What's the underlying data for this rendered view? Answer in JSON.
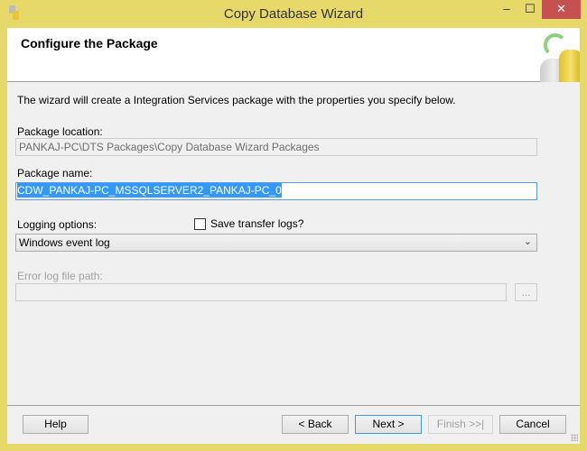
{
  "window": {
    "title": "Copy Database Wizard",
    "minimize": "‒",
    "maximize": "☐",
    "close": "✕",
    "app_icon": "database-copy-icon"
  },
  "header": {
    "title": "Configure the Package",
    "graphic": "database-copy-graphic"
  },
  "description": "The wizard will create a Integration Services package with the properties you specify below.",
  "package_location": {
    "label": "Package location:",
    "value": "PANKAJ-PC\\DTS Packages\\Copy Database Wizard Packages"
  },
  "package_name": {
    "label": "Package name:",
    "value": "CDW_PANKAJ-PC_MSSQLSERVER2_PANKAJ-PC_0"
  },
  "logging": {
    "label": "Logging options:",
    "selected": "Windows event log",
    "save_logs_label": "Save transfer logs?",
    "save_logs_checked": false
  },
  "error_log": {
    "label": "Error log file path:",
    "value": "",
    "browse_label": "..."
  },
  "footer": {
    "help": "Help",
    "back": "< Back",
    "next": "Next >",
    "finish": "Finish >>|",
    "cancel": "Cancel"
  }
}
